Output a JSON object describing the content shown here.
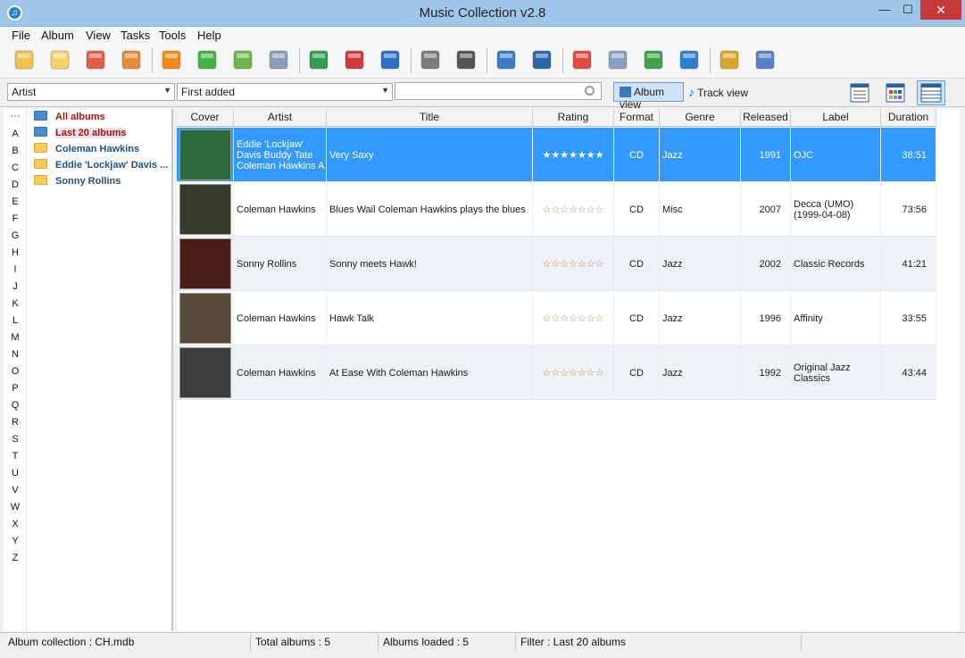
{
  "window": {
    "title": "Music Collection v2.8",
    "minimize": "—",
    "maximize": "☐",
    "close": "✕",
    "app_icon": "♫"
  },
  "menu": [
    "File",
    "Album",
    "View",
    "Tasks",
    "Tools",
    "Help"
  ],
  "toolbar": {
    "icons": [
      {
        "name": "add-album-icon",
        "color": "#f2c14e"
      },
      {
        "name": "open-album-icon",
        "color": "#f5d36a"
      },
      {
        "name": "import-disc-icon",
        "color": "#e35d4a"
      },
      {
        "name": "import-web-icon",
        "color": "#e88a3c"
      },
      {
        "name": "eject-icon",
        "color": "#f08a1c"
      },
      {
        "name": "download-icon",
        "color": "#43b343"
      },
      {
        "name": "search-online-icon",
        "color": "#6fb550"
      },
      {
        "name": "scan-icon",
        "color": "#8a9fb5"
      },
      {
        "name": "add-track-icon",
        "color": "#2f9e4f"
      },
      {
        "name": "remove-track-icon",
        "color": "#d23a3a"
      },
      {
        "name": "edit-icon",
        "color": "#2c6fc4"
      },
      {
        "name": "print-icon",
        "color": "#7c7c7c"
      },
      {
        "name": "html-export-icon",
        "color": "#555555"
      },
      {
        "name": "zoom-icon",
        "color": "#3a7cc8"
      },
      {
        "name": "find-icon",
        "color": "#2b62a8"
      },
      {
        "name": "calendar-icon",
        "color": "#e24a3f"
      },
      {
        "name": "document-icon",
        "color": "#8aa0bf"
      },
      {
        "name": "pie-chart-icon",
        "color": "#3fa34d"
      },
      {
        "name": "user-icon",
        "color": "#2f7fd0"
      },
      {
        "name": "plugin-icon",
        "color": "#d9a52a"
      },
      {
        "name": "book-icon",
        "color": "#5a7fc9"
      }
    ]
  },
  "filterbar": {
    "sort_field": "Artist",
    "sort_order": "First added",
    "search_placeholder": "",
    "album_view": "Album view",
    "track_view": "Track view"
  },
  "letters": [
    "···",
    "A",
    "B",
    "C",
    "D",
    "E",
    "F",
    "G",
    "H",
    "I",
    "J",
    "K",
    "L",
    "M",
    "N",
    "O",
    "P",
    "Q",
    "R",
    "S",
    "T",
    "U",
    "V",
    "W",
    "X",
    "Y",
    "Z"
  ],
  "tree": [
    {
      "label": "All albums",
      "style": "red",
      "folder": "blue"
    },
    {
      "label": "Last 20 albums",
      "style": "red",
      "folder": "blue",
      "selected": true
    },
    {
      "label": "Coleman Hawkins",
      "style": "blue",
      "folder": "yellow"
    },
    {
      "label": "Eddie 'Lockjaw' Davis ...",
      "style": "blue",
      "folder": "yellow"
    },
    {
      "label": "Sonny Rollins",
      "style": "blue",
      "folder": "yellow"
    }
  ],
  "grid": {
    "columns": [
      "Cover",
      "Artist",
      "Title",
      "Rating",
      "Format",
      "Genre",
      "Released",
      "Label",
      "Duration"
    ],
    "rows": [
      {
        "artist": "Eddie 'Lockjaw' Davis Buddy Tate Coleman Hawkins A",
        "title": "Very Saxy",
        "rating": "★★★★★★★",
        "format": "CD",
        "genre": "Jazz",
        "released": "1991",
        "label": "OJC",
        "duration": "38:51",
        "cover_color": "#2e6b3c",
        "selected": true
      },
      {
        "artist": "Coleman Hawkins",
        "title": "Blues Wail Coleman Hawkins plays the blues",
        "rating": "☆☆☆☆☆☆☆",
        "format": "CD",
        "genre": "Misc",
        "released": "2007",
        "label": "Decca (UMO) (1999-04-08)",
        "duration": "73:56",
        "cover_color": "#3a3a2a"
      },
      {
        "artist": "Sonny Rollins",
        "title": "Sonny meets Hawk!",
        "rating": "☆☆☆☆☆☆☆",
        "format": "CD",
        "genre": "Jazz",
        "released": "2002",
        "label": "Classic Records",
        "duration": "41:21",
        "cover_color": "#4a1f1a"
      },
      {
        "artist": "Coleman Hawkins",
        "title": "Hawk Talk",
        "rating": "☆☆☆☆☆☆☆",
        "format": "CD",
        "genre": "Jazz",
        "released": "1996",
        "label": "Affinity",
        "duration": "33:55",
        "cover_color": "#5a4a3a"
      },
      {
        "artist": "Coleman Hawkins",
        "title": "At Ease With Coleman Hawkins",
        "rating": "☆☆☆☆☆☆☆",
        "format": "CD",
        "genre": "Jazz",
        "released": "1992",
        "label": "Original Jazz Classics",
        "duration": "43:44",
        "cover_color": "#3d3d3d"
      }
    ]
  },
  "status": {
    "collection": "Album collection : CH.mdb",
    "total": "Total albums : 5",
    "loaded": "Albums loaded : 5",
    "filter": "Filter : Last 20 albums"
  }
}
